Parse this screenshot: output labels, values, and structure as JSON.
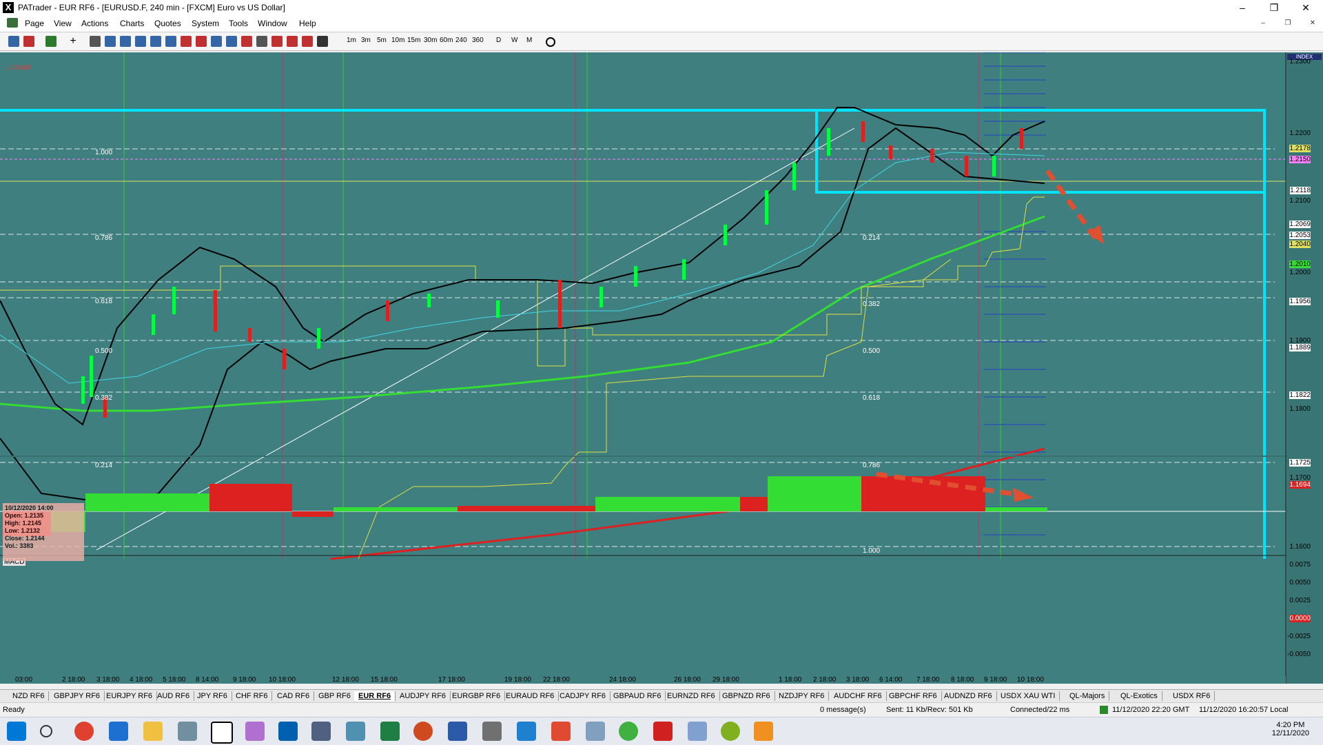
{
  "window": {
    "title": "PATrader - EUR RF6 - [EURUSD.F, 240 min - [FXCM] Euro vs US Dollar]",
    "app_icon": "X"
  },
  "menu": {
    "items": [
      "Page",
      "View",
      "Actions",
      "Charts",
      "Quotes",
      "System",
      "Tools",
      "Window",
      "Help"
    ]
  },
  "toolbar": {
    "timeframes": [
      "1m",
      "3m",
      "5m",
      "10m",
      "15m",
      "30m",
      "60m",
      "240",
      "360",
      "D",
      "W",
      "M"
    ]
  },
  "chart": {
    "locked_label": "Locked",
    "index_label": "INDEX",
    "indicator_label": "MACD",
    "background": "#3f7f7f",
    "price_labels": [
      "1.2300",
      "1.2200",
      "1.2178",
      "1.2150",
      "1.2118",
      "1.2100",
      "1.2069",
      "1.2053",
      "1.2040",
      "1.2010",
      "1.2000",
      "1.1956",
      "1.1900",
      "1.1889",
      "1.1822",
      "1.1800",
      "1.1725",
      "1.1700",
      "1.1694",
      "1.1600"
    ],
    "fib_left": [
      "1.000",
      "0.786",
      "0.618",
      "0.500",
      "0.382",
      "0.214"
    ],
    "fib_right": [
      "0.214",
      "0.382",
      "0.500",
      "0.618",
      "0.786",
      "1.000"
    ],
    "macd_labels": [
      "0.0075",
      "0.0050",
      "0.0025",
      "0.0000",
      "-0.0025",
      "-0.0050"
    ],
    "time_labels": [
      "03:00",
      "2 18:00",
      "3 18:00",
      "4 18:00",
      "5 18:00",
      "8 14:00",
      "9 18:00",
      "10 18:00",
      "12 18:00",
      "15 18:00",
      "17 18:00",
      "19 18:00",
      "22 18:00",
      "24 18:00",
      "26 18:00",
      "29 18:00",
      "1 18:00",
      "2 18:00",
      "3 18:00",
      "6 14:00",
      "7 18:00",
      "8 18:00",
      "9 18:00",
      "10 18:00"
    ],
    "info": {
      "date": "10/12/2020 14:00",
      "open": "Open: 1.2135",
      "high": "High: 1.2145",
      "low": "Low: 1.2132",
      "close": "Close: 1.2144",
      "vol": "Vol.: 3383"
    }
  },
  "tabs": [
    "NZD RF6",
    "GBPJPY RF6",
    "EURJPY RF6",
    "AUD RF6",
    "JPY RF6",
    "CHF RF6",
    "CAD RF6",
    "GBP RF6",
    "EUR RF6",
    "AUDJPY RF6",
    "EURGBP RF6",
    "EURAUD RF6",
    "CADJPY RF6",
    "GBPAUD RF6",
    "EURNZD RF6",
    "GBPNZD RF6",
    "NZDJPY RF6",
    "AUDCHF RF6",
    "GBPCHF RF6",
    "AUDNZD RF6",
    "USDX XAU WTI",
    "QL-Majors",
    "QL-Exotics",
    "USDX RF6"
  ],
  "active_tab": "EUR RF6",
  "status": {
    "ready": "Ready",
    "messages": "0 message(s)",
    "traffic": "Sent: 11 Kb/Recv: 501 Kb",
    "connection": "Connected/22 ms",
    "gmt": "11/12/2020 22:20 GMT",
    "local": "11/12/2020 16:20:57 Local"
  },
  "taskbar": {
    "time": "4:20 PM",
    "date": "12/11/2020"
  }
}
